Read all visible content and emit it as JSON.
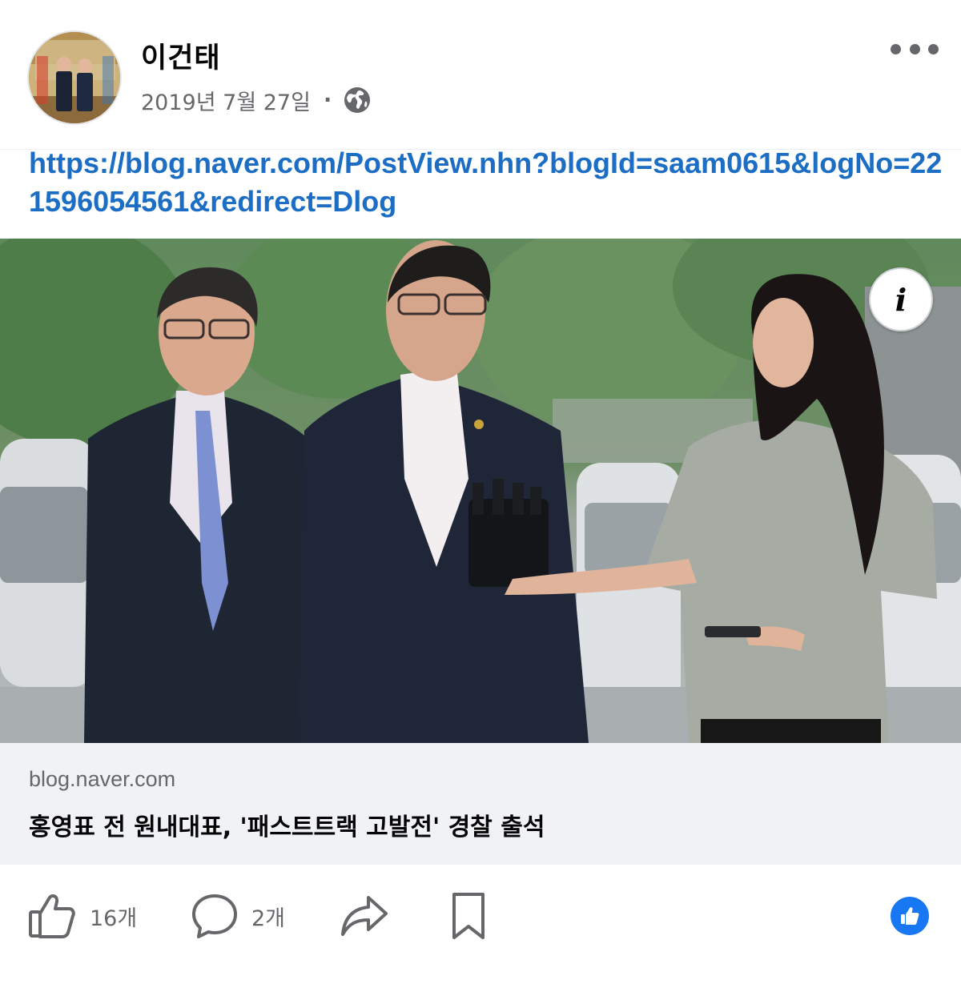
{
  "post": {
    "author": "이건태",
    "date": "2019년 7월 27일",
    "separator": "·",
    "privacy_icon": "globe-icon",
    "more_icon": "more-horizontal-icon",
    "link_text": "https://blog.naver.com/PostView.nhn?blogId=saam0615&logNo=221596054561&redirect=Dlog"
  },
  "preview": {
    "domain": "blog.naver.com",
    "title": "홍영표 전 원내대표, '패스트트랙 고발전' 경찰 출석",
    "info_label": "i"
  },
  "actions": {
    "like_count": "16개",
    "comment_count": "2개",
    "like_icon": "thumbs-up-icon",
    "comment_icon": "comment-bubble-icon",
    "share_icon": "share-arrow-icon",
    "save_icon": "bookmark-icon",
    "reaction_icon": "like-reaction-icon"
  },
  "colors": {
    "link": "#1c6dc4",
    "secondary_text": "#65676b",
    "preview_footer_bg": "#f0f2f5",
    "reaction_blue": "#1877f2"
  }
}
